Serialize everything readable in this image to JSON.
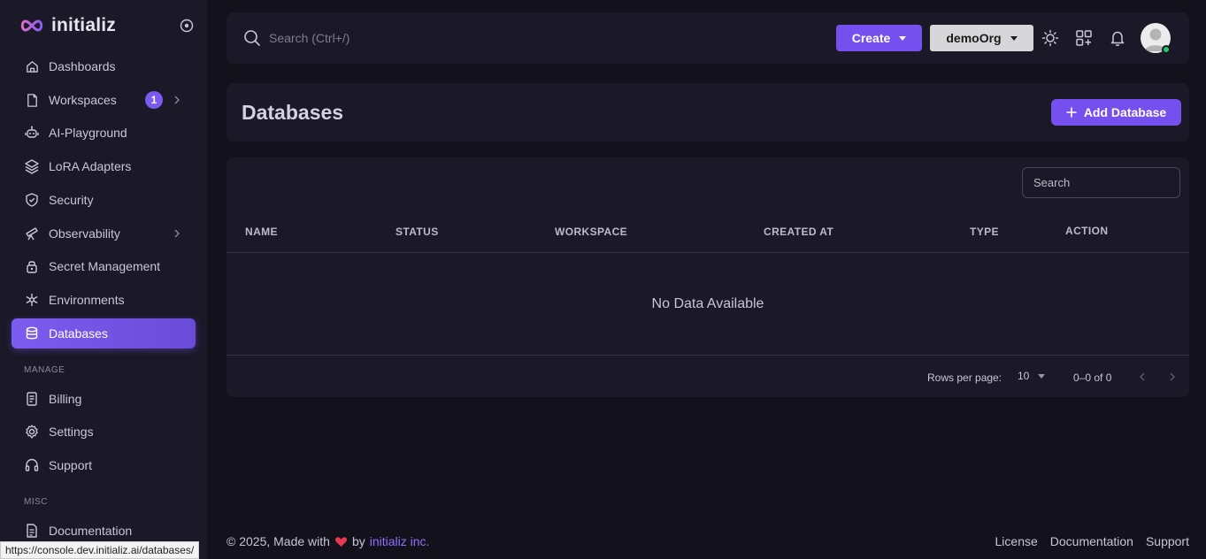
{
  "brand": {
    "name": "initializ"
  },
  "sidebar": {
    "items": [
      {
        "label": "Dashboards",
        "icon": "home-icon"
      },
      {
        "label": "Workspaces",
        "icon": "file-icon",
        "badge": "1"
      },
      {
        "label": "AI-Playground",
        "icon": "robot-icon"
      },
      {
        "label": "LoRA Adapters",
        "icon": "layers-icon"
      },
      {
        "label": "Security",
        "icon": "shield-icon"
      },
      {
        "label": "Observability",
        "icon": "telescope-icon"
      },
      {
        "label": "Secret Management",
        "icon": "lock-icon"
      },
      {
        "label": "Environments",
        "icon": "network-icon"
      },
      {
        "label": "Databases",
        "icon": "database-icon"
      }
    ],
    "manage_label": "MANAGE",
    "manage_items": [
      {
        "label": "Billing",
        "icon": "receipt-icon"
      },
      {
        "label": "Settings",
        "icon": "gear-icon"
      },
      {
        "label": "Support",
        "icon": "headset-icon"
      }
    ],
    "misc_label": "MISC",
    "misc_items": [
      {
        "label": "Documentation",
        "icon": "doc-icon"
      }
    ]
  },
  "topbar": {
    "search_placeholder": "Search (Ctrl+/)",
    "create_label": "Create",
    "org_label": "demoOrg"
  },
  "page": {
    "title": "Databases",
    "add_label": "Add Database"
  },
  "table": {
    "search_placeholder": "Search",
    "columns": [
      "NAME",
      "STATUS",
      "WORKSPACE",
      "CREATED AT",
      "TYPE",
      "ACTION"
    ],
    "empty_message": "No Data Available",
    "rows_per_page_label": "Rows per page:",
    "rows_per_page_value": "10",
    "range_text": "0–0 of 0"
  },
  "footer": {
    "copyright": "© 2025, Made with",
    "by": "by",
    "company": "initializ inc.",
    "links": [
      "License",
      "Documentation",
      "Support"
    ]
  },
  "status_bar": {
    "url": "https://console.dev.initializ.ai/databases/"
  },
  "colors": {
    "accent": "#7650ef",
    "sidebar_bg": "#1b1927",
    "page_bg": "#13111c",
    "online": "#28c76f",
    "heart": "#e53950"
  }
}
